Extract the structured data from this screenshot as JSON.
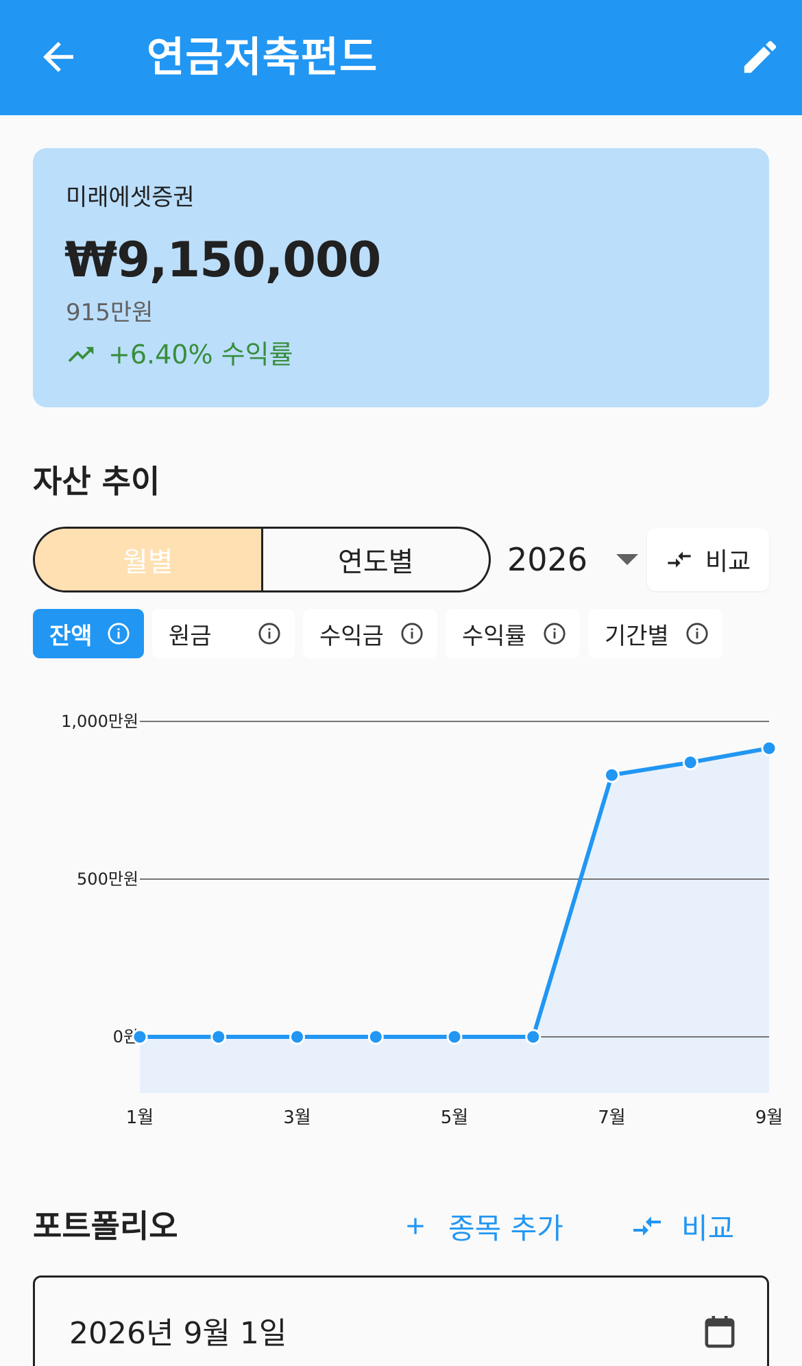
{
  "appbar": {
    "title": "연금저축펀드"
  },
  "summary": {
    "broker": "미래에셋증권",
    "amount": "₩9,150,000",
    "amount_kr": "915만원",
    "return_text": "+6.40% 수익률"
  },
  "trend": {
    "title": "자산 추이",
    "segments": [
      "월별",
      "연도별"
    ],
    "active_segment": 0,
    "year": "2026",
    "compare": "비교",
    "chips": [
      {
        "label": "잔액",
        "active": true
      },
      {
        "label": "원금",
        "active": false
      },
      {
        "label": "수익금",
        "active": false
      },
      {
        "label": "수익률",
        "active": false
      },
      {
        "label": "기간별",
        "active": false
      }
    ]
  },
  "chart_data": {
    "type": "area",
    "x": [
      "1월",
      "2월",
      "3월",
      "4월",
      "5월",
      "6월",
      "7월",
      "8월",
      "9월"
    ],
    "xtick_labels": [
      "1월",
      "3월",
      "5월",
      "7월",
      "9월"
    ],
    "values": [
      0,
      0,
      0,
      0,
      0,
      0,
      8300000,
      8700000,
      9150000
    ],
    "ytick_labels": [
      "1,000만원",
      "500만원",
      "0원"
    ],
    "yticks": [
      10000000,
      5000000,
      0
    ],
    "ylim": [
      -1800000,
      10000000
    ],
    "grid": true,
    "line_color": "#2196f3",
    "fill_color": "#e8f1fb"
  },
  "portfolio": {
    "title": "포트폴리오",
    "add": "종목 추가",
    "compare": "비교",
    "date": "2026년 9월 1일"
  },
  "colors": {
    "primary": "#2196f3",
    "card": "#bbdefb",
    "positive": "#388e3c",
    "segment_active": "#ffe0b2"
  }
}
